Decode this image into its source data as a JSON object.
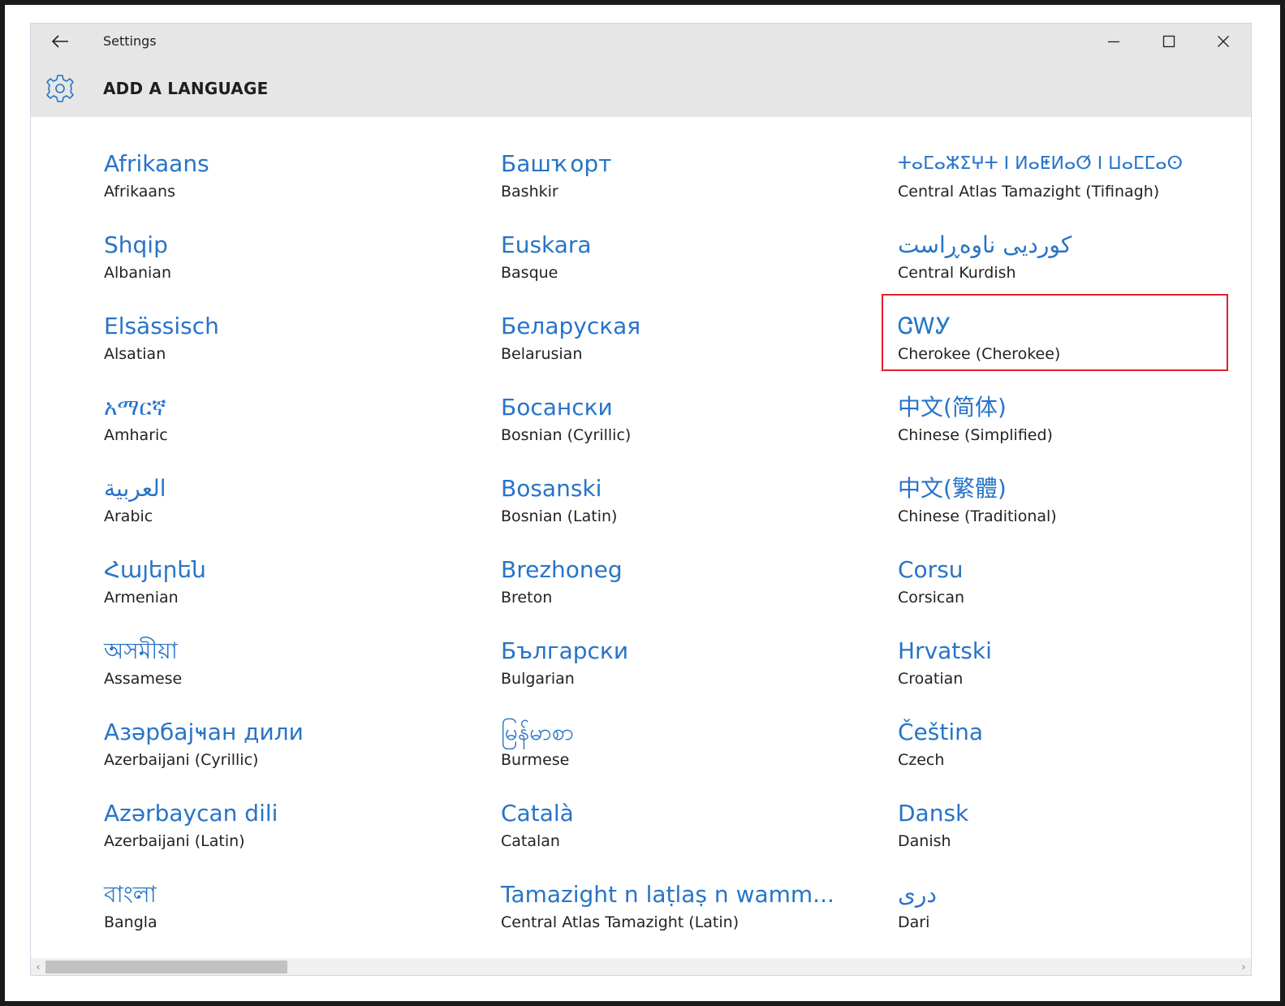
{
  "app": {
    "title": "Settings"
  },
  "page": {
    "title": "ADD A LANGUAGE"
  },
  "columns": [
    [
      {
        "native": "Afrikaans",
        "english": "Afrikaans"
      },
      {
        "native": "Shqip",
        "english": "Albanian"
      },
      {
        "native": "Elsässisch",
        "english": "Alsatian"
      },
      {
        "native": "አማርኛ",
        "english": "Amharic"
      },
      {
        "native": "العربية",
        "english": "Arabic"
      },
      {
        "native": "Հայերեն",
        "english": "Armenian"
      },
      {
        "native": "অসমীয়া",
        "english": "Assamese"
      },
      {
        "native": "Азәрбајҹан дили",
        "english": "Azerbaijani (Cyrillic)"
      },
      {
        "native": "Azərbaycan dili",
        "english": "Azerbaijani (Latin)"
      },
      {
        "native": "বাংলা",
        "english": "Bangla"
      }
    ],
    [
      {
        "native": "Башҡорт",
        "english": "Bashkir"
      },
      {
        "native": "Euskara",
        "english": "Basque"
      },
      {
        "native": "Беларуская",
        "english": "Belarusian"
      },
      {
        "native": "Босански",
        "english": "Bosnian (Cyrillic)"
      },
      {
        "native": "Bosanski",
        "english": "Bosnian (Latin)"
      },
      {
        "native": "Brezhoneg",
        "english": "Breton"
      },
      {
        "native": "Български",
        "english": "Bulgarian"
      },
      {
        "native": "မြန်မာစာ",
        "english": "Burmese"
      },
      {
        "native": "Català",
        "english": "Catalan"
      },
      {
        "native": "Tamazight n laṭlaṣ n wamm...",
        "english": "Central Atlas Tamazight (Latin)"
      }
    ],
    [
      {
        "native": "ⵜⴰⵎⴰⵣⵉⵖⵜ ⵏ ⵍⴰⵟⵍⴰⵚ ⵏ ⵡⴰⵎⵎⴰⵙ",
        "english": "Central Atlas Tamazight (Tifinagh)"
      },
      {
        "native": "کوردیی ناوەڕاست",
        "english": "Central Kurdish"
      },
      {
        "native": "ᏣᎳᎩ",
        "english": "Cherokee (Cherokee)",
        "selected": true
      },
      {
        "native": "中文(简体)",
        "english": "Chinese (Simplified)"
      },
      {
        "native": "中文(繁體)",
        "english": "Chinese (Traditional)"
      },
      {
        "native": "Corsu",
        "english": "Corsican"
      },
      {
        "native": "Hrvatski",
        "english": "Croatian"
      },
      {
        "native": "Čeština",
        "english": "Czech"
      },
      {
        "native": "Dansk",
        "english": "Danish"
      },
      {
        "native": "دری",
        "english": "Dari"
      }
    ]
  ],
  "scrollbar": {
    "left_arrow": "‹",
    "right_arrow": "›"
  }
}
